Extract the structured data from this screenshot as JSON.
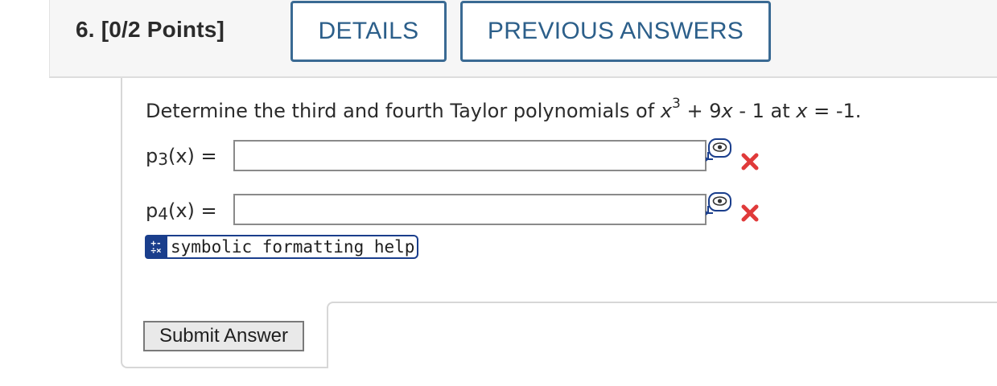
{
  "question": {
    "number_label": "6.",
    "points_label": "[0/2 Points]",
    "details_button": "DETAILS",
    "previous_answers_button": "PREVIOUS ANSWERS",
    "prompt_prefix": "Determine the third and fourth Taylor polynomials of ",
    "prompt_base": "x",
    "prompt_exponent": "3",
    "prompt_middle": " + 9",
    "prompt_x2": "x",
    "prompt_middle2": " - 1 at ",
    "prompt_x3": "x",
    "prompt_suffix": " = -1."
  },
  "answers": [
    {
      "label_p": "p",
      "label_sub": "3",
      "label_rest": "(x)  =",
      "value": "",
      "status": "incorrect"
    },
    {
      "label_p": "p",
      "label_sub": "4",
      "label_rest": "(x)  =",
      "value": "",
      "status": "incorrect"
    }
  ],
  "icons": {
    "preview": "preview-eye-icon",
    "incorrect": "red-x-icon",
    "symbolic_badge": "plus-minus-badge-icon"
  },
  "colors": {
    "accent": "#2c5f8a",
    "incorrect": "#e03a3a",
    "badge": "#1a3e8c"
  },
  "symbolic_help_label": "symbolic formatting help",
  "submit_label": "Submit Answer"
}
